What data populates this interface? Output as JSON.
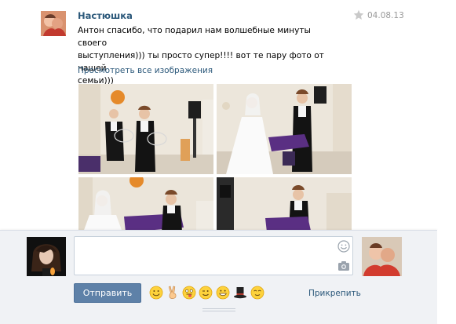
{
  "post": {
    "author": "Настюшка",
    "date": "04.08.13",
    "text_lines": [
      "Антон спасибо, что подарил нам волшебные минуты своего",
      "выступления))) ты просто супер!!!! вот те пару фото от нашей",
      "семьи)))"
    ],
    "view_all_label": "Просмотреть все изображения",
    "photos": [
      {
        "icon": "photo-performer-rings"
      },
      {
        "icon": "photo-bride-performer"
      },
      {
        "icon": "photo-bride-table"
      },
      {
        "icon": "photo-performer-table"
      }
    ]
  },
  "composer": {
    "input_value": "",
    "send_label": "Отправить",
    "attach_label": "Прикрепить",
    "emoji": [
      "smile",
      "victory-hand",
      "tongue",
      "wink",
      "grin",
      "top-hat",
      "relieved"
    ]
  },
  "colors": {
    "link": "#2b587a",
    "button": "#5e81a8",
    "composer_bg": "#f0f2f5",
    "date": "#999999"
  }
}
